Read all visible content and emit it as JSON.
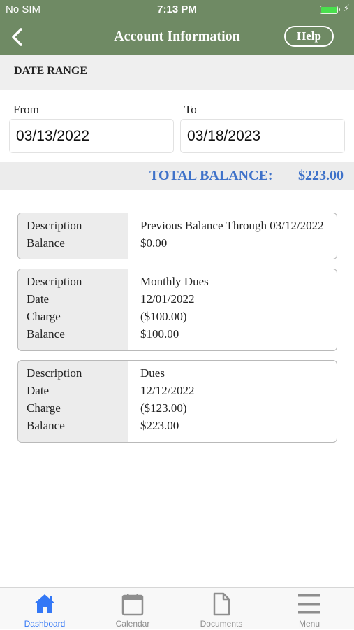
{
  "status_bar": {
    "carrier": "No SIM",
    "time": "7:13 PM",
    "battery_level": 1.0
  },
  "nav": {
    "back_icon": "chevron-left-icon",
    "title": "Account Information",
    "help_label": "Help"
  },
  "date_range": {
    "header": "DATE RANGE",
    "from_label": "From",
    "from_value": "03/13/2022",
    "to_label": "To",
    "to_value": "03/18/2023"
  },
  "total": {
    "label": "TOTAL BALANCE:",
    "amount": "$223.00",
    "color": "#3f72c9"
  },
  "transactions": [
    {
      "rows": [
        {
          "label": "Description",
          "value": "Previous Balance Through 03/12/2022"
        },
        {
          "label": "Balance",
          "value": "$0.00"
        }
      ]
    },
    {
      "rows": [
        {
          "label": "Description",
          "value": "Monthly Dues"
        },
        {
          "label": "Date",
          "value": "12/01/2022"
        },
        {
          "label": "Charge",
          "value": "($100.00)"
        },
        {
          "label": "Balance",
          "value": "$100.00"
        }
      ]
    },
    {
      "rows": [
        {
          "label": "Description",
          "value": "Dues"
        },
        {
          "label": "Date",
          "value": "12/12/2022"
        },
        {
          "label": "Charge",
          "value": "($123.00)"
        },
        {
          "label": "Balance",
          "value": "$223.00"
        }
      ]
    }
  ],
  "tab_bar": {
    "items": [
      {
        "label": "Dashboard",
        "icon": "home-icon",
        "active": true
      },
      {
        "label": "Calendar",
        "icon": "calendar-icon",
        "active": false
      },
      {
        "label": "Documents",
        "icon": "document-icon",
        "active": false
      },
      {
        "label": "Menu",
        "icon": "hamburger-menu-icon",
        "active": false
      }
    ]
  },
  "colors": {
    "header_green": "#6f8a64",
    "active_tab_blue": "#3478f6",
    "inactive_tab_gray": "#8e8e8e"
  }
}
